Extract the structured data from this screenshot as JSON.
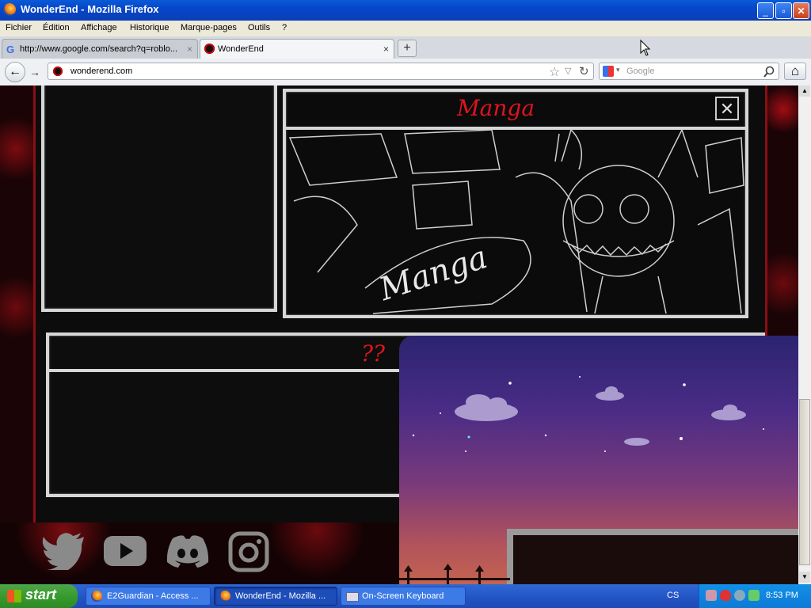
{
  "window": {
    "title": "WonderEnd - Mozilla Firefox",
    "controls": {
      "minimize": "_",
      "maximize": "▫",
      "close": "✕"
    }
  },
  "menu": {
    "items": [
      "Fichier",
      "Édition",
      "Affichage",
      "Historique",
      "Marque-pages",
      "Outils",
      "?"
    ]
  },
  "tabs": [
    {
      "label": "http://www.google.com/search?q=roblo...",
      "close": "×"
    },
    {
      "label": "WonderEnd",
      "close": "×"
    }
  ],
  "new_tab": "+",
  "nav": {
    "back": "←",
    "forward": "→",
    "url": "wonderend.com",
    "bookmark_star": "☆",
    "dropdown": "▽",
    "reload": "↻",
    "search_placeholder": "Google",
    "search_icon": "magnifier-icon",
    "home": "⌂"
  },
  "page": {
    "manga_title": "Manga",
    "manga_art_text": "Manga",
    "close_x": "✕",
    "question_marks": "??",
    "social": [
      "twitter-icon",
      "youtube-icon",
      "discord-icon",
      "instagram-icon"
    ]
  },
  "taskbar": {
    "start": "start",
    "tasks": [
      {
        "label": "E2Guardian - Access ..."
      },
      {
        "label": "WonderEnd - Mozilla ..."
      },
      {
        "label": "On-Screen Keyboard"
      }
    ],
    "language": "CS",
    "clock": "8:53 PM"
  },
  "colors": {
    "accent_red": "#e0141e",
    "chalk": "#d6d6d6",
    "xp_blue": "#2456c7"
  }
}
